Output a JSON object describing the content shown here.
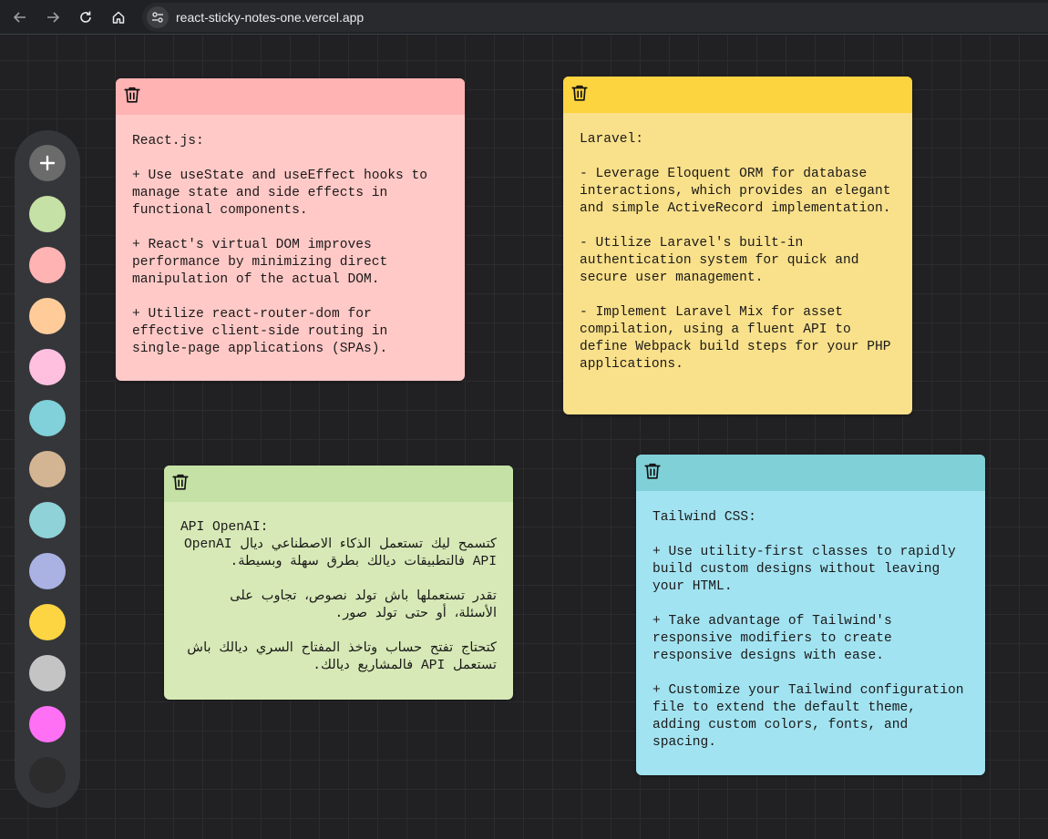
{
  "browser": {
    "url": "react-sticky-notes-one.vercel.app",
    "icons": [
      "back-icon",
      "forward-icon",
      "reload-icon",
      "home-icon",
      "site-info-icon"
    ]
  },
  "sidebar": {
    "add_icon": "plus-icon",
    "colors": [
      "#c5e1a5",
      "#ffb3b3",
      "#ffcc99",
      "#ffc0e0",
      "#80d1d9",
      "#d4b593",
      "#8fd3d9",
      "#a9b2e3",
      "#fdd542",
      "#c4c4c4",
      "#ff70f5",
      "#2c2c2c"
    ]
  },
  "notes": [
    {
      "header_color": "#ffb3b3",
      "body_color": "#ffc9c7",
      "text": "React.js:\n\n+ Use useState and useEffect hooks to manage state and side effects in functional components.\n\n+ React's virtual DOM improves performance by minimizing direct manipulation of the actual DOM.\n\n+ Utilize react-router-dom for effective client-side routing in single-page applications (SPAs)."
    },
    {
      "header_color": "#fcd43f",
      "body_color": "#f9e08a",
      "text": "Laravel:\n\n- Leverage Eloquent ORM for database interactions, which provides an elegant and simple ActiveRecord implementation.\n\n- Utilize Laravel's built-in authentication system for quick and secure user management.\n\n- Implement Laravel Mix for asset compilation, using a fluent API to define Webpack build steps for your PHP applications."
    },
    {
      "header_color": "#c5e1a5",
      "body_color": "#d7e9b6",
      "text": "API OpenAI:\nكتسمح ليك تستعمل الذكاء الاصطناعي ديال OpenAI API فالتطبيقات ديالك بطرق سهلة وبسيطة.\n\nتقدر تستعملها باش تولد نصوص، تجاوب على الأسئلة، أو حتى تولد صور.\n\nكتحتاج تفتح حساب وتاخذ المفتاح السري ديالك باش تستعمل API فالمشاريع ديالك."
    },
    {
      "header_color": "#80d0d8",
      "body_color": "#a2e3f1",
      "text": "Tailwind CSS:\n\n+ Use utility-first classes to rapidly build custom designs without leaving your HTML.\n\n+ Take advantage of Tailwind's responsive modifiers to create responsive designs with ease.\n\n+ Customize your Tailwind configuration file to extend the default theme, adding custom colors, fonts, and spacing."
    }
  ]
}
